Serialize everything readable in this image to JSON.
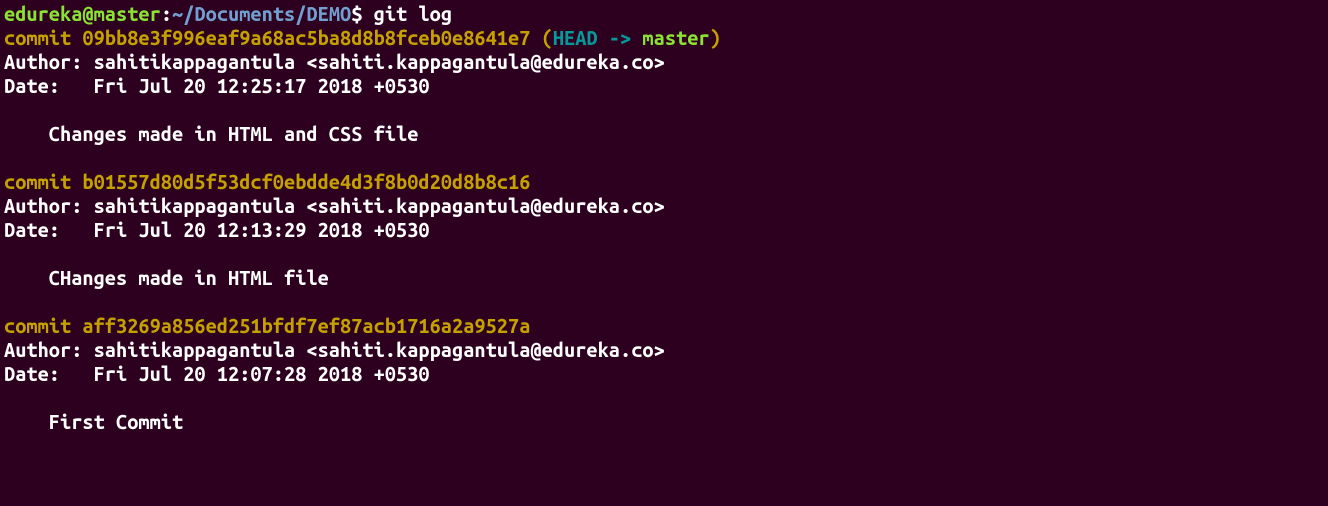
{
  "prompt": {
    "user": "edureka@master",
    "sep1": ":",
    "path": "~/Documents/DEMO",
    "sep2": "$",
    "command": "git log"
  },
  "commits": [
    {
      "commit_prefix": "commit ",
      "hash": "09bb8e3f996eaf9a68ac5ba8d8b8fceb0e8641e7",
      "has_head": true,
      "paren_open": " (",
      "head_label": "HEAD -> ",
      "branch": "master",
      "paren_close": ")",
      "author_line": "Author: sahitikappagantula <sahiti.kappagantula@edureka.co>",
      "date_line": "Date:   Fri Jul 20 12:25:17 2018 +0530",
      "message": "    Changes made in HTML and CSS file"
    },
    {
      "commit_prefix": "commit ",
      "hash": "b01557d80d5f53dcf0ebdde4d3f8b0d20d8b8c16",
      "has_head": false,
      "author_line": "Author: sahitikappagantula <sahiti.kappagantula@edureka.co>",
      "date_line": "Date:   Fri Jul 20 12:13:29 2018 +0530",
      "message": "    CHanges made in HTML file"
    },
    {
      "commit_prefix": "commit ",
      "hash": "aff3269a856ed251bfdf7ef87acb1716a2a9527a",
      "has_head": false,
      "author_line": "Author: sahitikappagantula <sahiti.kappagantula@edureka.co>",
      "date_line": "Date:   Fri Jul 20 12:07:28 2018 +0530",
      "message": "    First Commit"
    }
  ]
}
